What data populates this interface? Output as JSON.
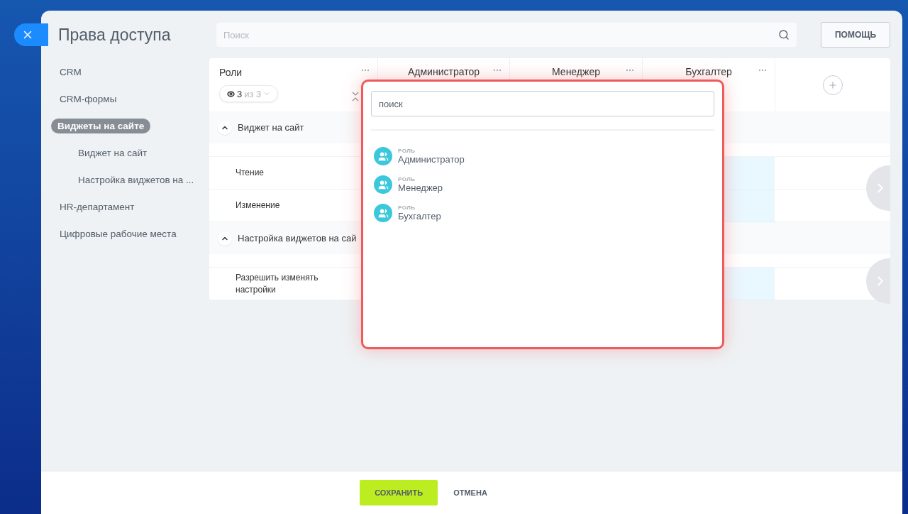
{
  "title": "Права доступа",
  "search": {
    "placeholder": "Поиск"
  },
  "help_button": "ПОМОЩЬ",
  "sidebar": {
    "items": [
      {
        "label": "CRM",
        "selected": false
      },
      {
        "label": "CRM-формы",
        "selected": false
      },
      {
        "label": "Виджеты на сайте",
        "selected": true,
        "children": [
          {
            "label": "Виджет на сайт",
            "selected": false
          },
          {
            "label": "Настройка виджетов на ...",
            "selected": false
          }
        ]
      },
      {
        "label": "HR-департамент",
        "selected": false
      },
      {
        "label": "Цифровые рабочие места",
        "selected": false
      }
    ]
  },
  "table": {
    "roles_header": "Роли",
    "filter": {
      "shown": "3",
      "total": "из 3"
    },
    "columns": [
      "Администратор",
      "Менеджер",
      "Бухгалтер"
    ],
    "sections": [
      {
        "title": "Виджет на сайт",
        "expanded": true,
        "rows": [
          "Чтение",
          "Изменение"
        ]
      },
      {
        "title": "Настройка виджетов на сай",
        "expanded": true,
        "rows": [
          "Разрешить изменять настройки"
        ]
      }
    ]
  },
  "popup": {
    "search": {
      "placeholder": "поиск"
    },
    "items": [
      {
        "caption": "РОЛЬ",
        "name": "Администратор"
      },
      {
        "caption": "РОЛЬ",
        "name": "Менеджер"
      },
      {
        "caption": "РОЛЬ",
        "name": "Бухгалтер"
      }
    ]
  },
  "footer": {
    "save": "СОХРАНИТЬ",
    "cancel": "ОТМЕНА"
  }
}
